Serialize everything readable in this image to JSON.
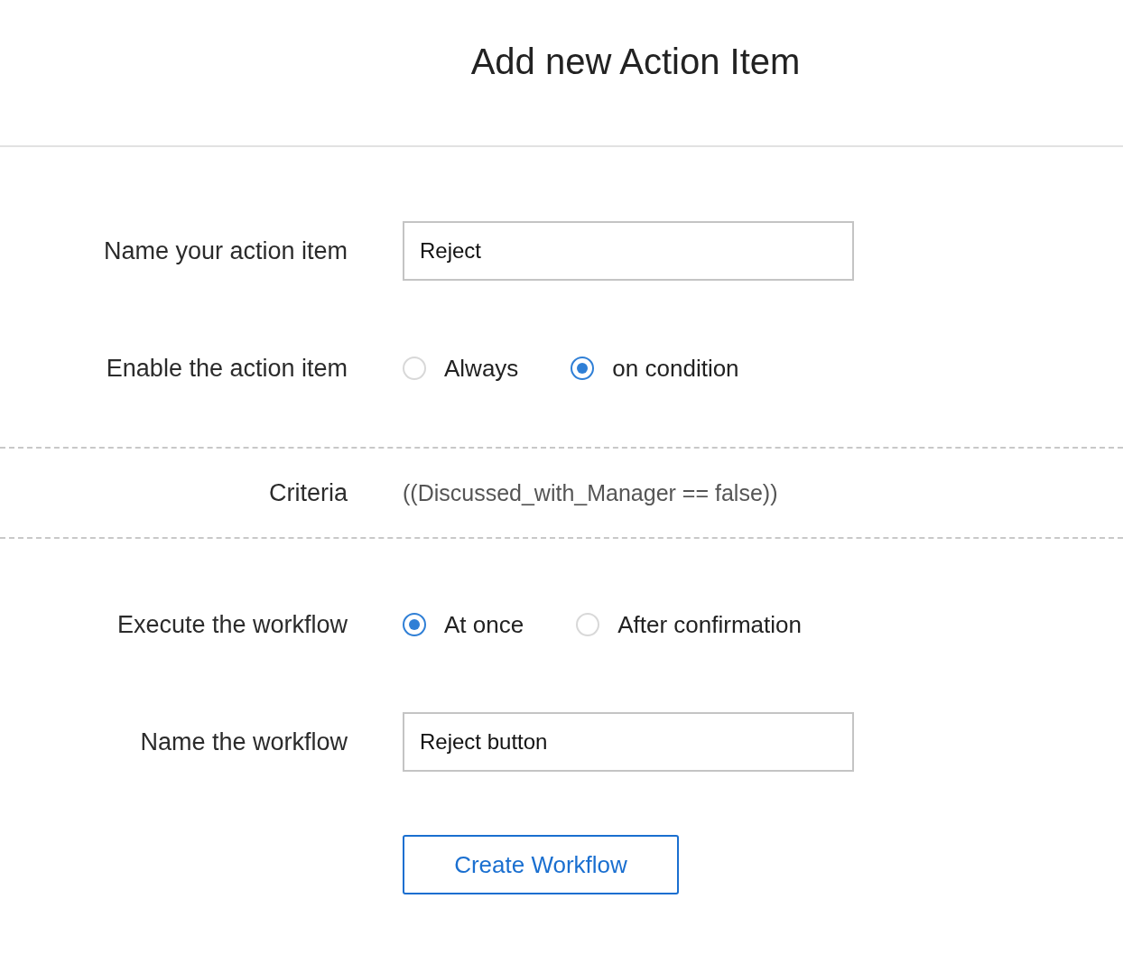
{
  "title": "Add new Action Item",
  "fields": [
    {
      "kind": "text",
      "label": "Name your action item",
      "value": "Reject"
    },
    {
      "kind": "radio",
      "label": "Enable the action item",
      "options": [
        {
          "label": "Always",
          "selected": false
        },
        {
          "label": "on condition",
          "selected": true
        }
      ]
    },
    {
      "kind": "criteria",
      "label": "Criteria",
      "value": "((Discussed_with_Manager == false))"
    },
    {
      "kind": "radio",
      "label": "Execute the workflow",
      "options": [
        {
          "label": "At once",
          "selected": true
        },
        {
          "label": "After confirmation",
          "selected": false
        }
      ]
    },
    {
      "kind": "text",
      "label": "Name the workflow",
      "value": "Reject button"
    }
  ],
  "button": "Create Workflow"
}
